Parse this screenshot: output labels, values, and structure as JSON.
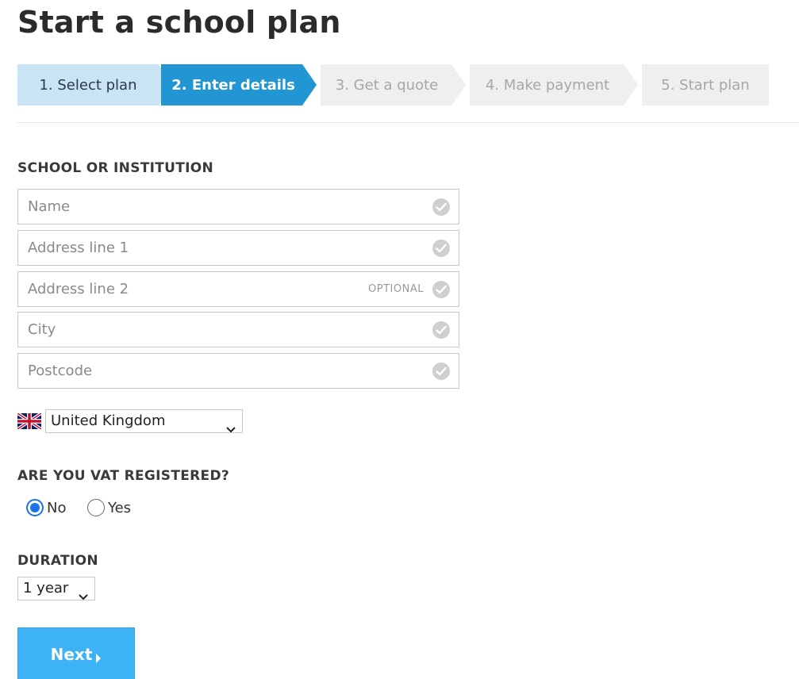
{
  "page": {
    "title": "Start a school plan"
  },
  "steps": [
    {
      "label": "1. Select plan",
      "state": "done"
    },
    {
      "label": "2. Enter details",
      "state": "active"
    },
    {
      "label": "3. Get a quote",
      "state": "pending"
    },
    {
      "label": "4. Make payment",
      "state": "pending"
    },
    {
      "label": "5. Start plan",
      "state": "pending"
    }
  ],
  "school": {
    "heading": "SCHOOL OR INSTITUTION",
    "fields": [
      {
        "placeholder": "Name",
        "value": ""
      },
      {
        "placeholder": "Address line 1",
        "value": ""
      },
      {
        "placeholder": "Address line 2",
        "value": "",
        "tag": "OPTIONAL"
      },
      {
        "placeholder": "City",
        "value": ""
      },
      {
        "placeholder": "Postcode",
        "value": ""
      }
    ],
    "country": {
      "selected": "United Kingdom",
      "flag_icon": "uk-flag-icon"
    }
  },
  "vat": {
    "heading": "ARE YOU VAT REGISTERED?",
    "options": [
      {
        "label": "No",
        "checked": true
      },
      {
        "label": "Yes",
        "checked": false
      }
    ]
  },
  "duration": {
    "heading": "DURATION",
    "selected": "1 year"
  },
  "actions": {
    "next_label": "Next"
  },
  "colors": {
    "active_step": "#2196d3",
    "done_step": "#c9e4f5",
    "pending_step": "#efefef",
    "next_button": "#3db2f5",
    "radio_accent": "#1a73e8"
  }
}
